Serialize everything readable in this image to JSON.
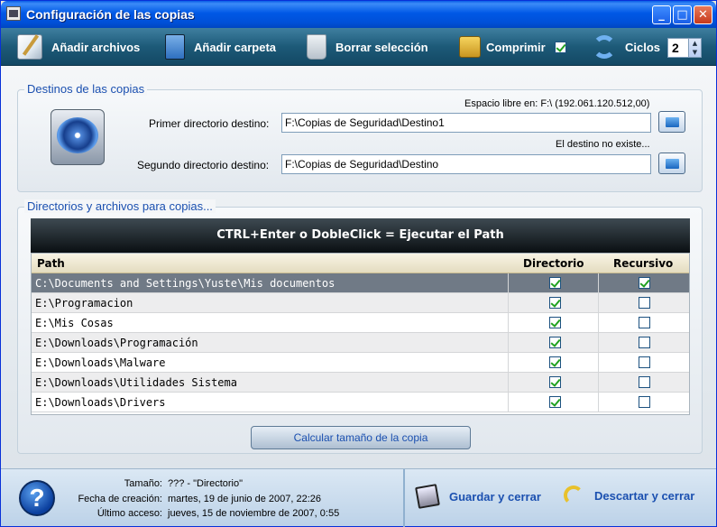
{
  "window": {
    "title": "Configuración de las copias"
  },
  "toolbar": {
    "add_files": "Añadir archivos",
    "add_folder": "Añadir carpeta",
    "delete_selection": "Borrar selección",
    "compress": "Comprimir",
    "compress_checked": true,
    "cycles_label": "Ciclos",
    "cycles_value": "2"
  },
  "destinations": {
    "title": "Destinos de las copias",
    "free_space": "Espacio libre en: F:\\ (192.061.120.512,00)",
    "first_label": "Primer directorio destino:",
    "first_value": "F:\\Copias de Seguridad\\Destino1",
    "dest_warning": "El destino no existe...",
    "second_label": "Segundo directorio destino:",
    "second_value": "F:\\Copias de Seguridad\\Destino"
  },
  "sources": {
    "title": "Directorios y archivos para copias...",
    "banner": "CTRL+Enter o DobleClick = Ejecutar el Path",
    "columns": [
      "Path",
      "Directorio",
      "Recursivo"
    ],
    "rows": [
      {
        "path": "C:\\Documents and Settings\\Yuste\\Mis documentos",
        "directorio": true,
        "recursivo": true
      },
      {
        "path": "E:\\Programacion",
        "directorio": true,
        "recursivo": false
      },
      {
        "path": "E:\\Mis Cosas",
        "directorio": true,
        "recursivo": false
      },
      {
        "path": "E:\\Downloads\\Programación",
        "directorio": true,
        "recursivo": false
      },
      {
        "path": "E:\\Downloads\\Malware",
        "directorio": true,
        "recursivo": false
      },
      {
        "path": "E:\\Downloads\\Utilidades Sistema",
        "directorio": true,
        "recursivo": false
      },
      {
        "path": "E:\\Downloads\\Drivers",
        "directorio": true,
        "recursivo": false
      }
    ],
    "calc_button": "Calcular tamaño de la copia"
  },
  "info": {
    "size_label": "Tamaño:",
    "size_value": "??? - \"Directorio\"",
    "created_label": "Fecha de creación:",
    "created_value": "martes, 19 de junio de 2007, 22:26",
    "accessed_label": "Último acceso:",
    "accessed_value": "jueves, 15 de noviembre de 2007, 0:55"
  },
  "actions": {
    "save_close": "Guardar y cerrar",
    "discard_close": "Descartar y cerrar"
  }
}
